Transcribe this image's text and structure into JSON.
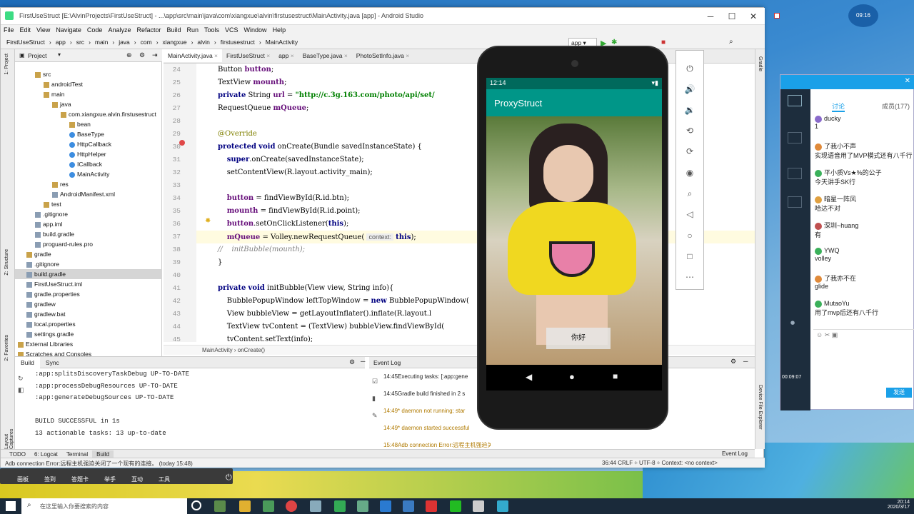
{
  "window": {
    "title": "FirstUseStruct [E:\\AlvinProjects\\FirstUseStruct] - ...\\app\\src\\main\\java\\com\\xiangxue\\alvin\\firstusestruct\\MainActivity.java [app] - Android Studio",
    "minimize": "─",
    "maximize": "☐",
    "close": "✕"
  },
  "menu": [
    "File",
    "Edit",
    "View",
    "Navigate",
    "Code",
    "Analyze",
    "Refactor",
    "Build",
    "Run",
    "Tools",
    "VCS",
    "Window",
    "Help"
  ],
  "breadcrumbs": [
    "FirstUseStruct",
    "app",
    "src",
    "main",
    "java",
    "com",
    "xiangxue",
    "alvin",
    "firstusestruct",
    "MainActivity"
  ],
  "run_config": "app",
  "project_panel": {
    "title": "Project",
    "tree": [
      {
        "label": "src",
        "indent": 2,
        "type": "folder"
      },
      {
        "label": "androidTest",
        "indent": 3,
        "type": "folder"
      },
      {
        "label": "main",
        "indent": 3,
        "type": "folder"
      },
      {
        "label": "java",
        "indent": 4,
        "type": "folder"
      },
      {
        "label": "com.xiangxue.alvin.firstusestruct",
        "indent": 5,
        "type": "folder"
      },
      {
        "label": "bean",
        "indent": 6,
        "type": "folder"
      },
      {
        "label": "BaseType",
        "indent": 6,
        "type": "cls"
      },
      {
        "label": "HttpCallback",
        "indent": 6,
        "type": "cls"
      },
      {
        "label": "HttpHelper",
        "indent": 6,
        "type": "cls"
      },
      {
        "label": "ICallback",
        "indent": 6,
        "type": "cls"
      },
      {
        "label": "MainActivity",
        "indent": 6,
        "type": "cls"
      },
      {
        "label": "res",
        "indent": 4,
        "type": "folder"
      },
      {
        "label": "AndroidManifest.xml",
        "indent": 4,
        "type": "file"
      },
      {
        "label": "test",
        "indent": 3,
        "type": "folder"
      },
      {
        "label": ".gitignore",
        "indent": 2,
        "type": "file"
      },
      {
        "label": "app.iml",
        "indent": 2,
        "type": "file"
      },
      {
        "label": "build.gradle",
        "indent": 2,
        "type": "file"
      },
      {
        "label": "proguard-rules.pro",
        "indent": 2,
        "type": "file"
      },
      {
        "label": "gradle",
        "indent": 1,
        "type": "folder"
      },
      {
        "label": ".gitignore",
        "indent": 1,
        "type": "file"
      },
      {
        "label": "build.gradle",
        "indent": 1,
        "type": "file",
        "selected": true
      },
      {
        "label": "FirstUseStruct.iml",
        "indent": 1,
        "type": "file"
      },
      {
        "label": "gradle.properties",
        "indent": 1,
        "type": "file"
      },
      {
        "label": "gradlew",
        "indent": 1,
        "type": "file"
      },
      {
        "label": "gradlew.bat",
        "indent": 1,
        "type": "file"
      },
      {
        "label": "local.properties",
        "indent": 1,
        "type": "file"
      },
      {
        "label": "settings.gradle",
        "indent": 1,
        "type": "file"
      },
      {
        "label": "External Libraries",
        "indent": 0,
        "type": "folder"
      },
      {
        "label": "Scratches and Consoles",
        "indent": 0,
        "type": "folder"
      }
    ]
  },
  "editor_tabs": [
    {
      "label": "MainActivity.java",
      "active": true
    },
    {
      "label": "FirstUseStruct",
      "active": false
    },
    {
      "label": "app",
      "active": false
    },
    {
      "label": "BaseType.java",
      "active": false
    },
    {
      "label": "PhotoSetInfo.java",
      "active": false
    }
  ],
  "code_lines": [
    {
      "n": "24",
      "t": "Button button;"
    },
    {
      "n": "25",
      "t": "TextView mounth;"
    },
    {
      "n": "26",
      "t": "private String url = \"http://c.3g.163.com/photo/api/set/"
    },
    {
      "n": "27",
      "t": "RequestQueue mQueue;"
    },
    {
      "n": "28",
      "t": ""
    },
    {
      "n": "29",
      "t": "@Override"
    },
    {
      "n": "30",
      "t": "protected void onCreate(Bundle savedInstanceState) {"
    },
    {
      "n": "31",
      "t": "    super.onCreate(savedInstanceState);"
    },
    {
      "n": "32",
      "t": "    setContentView(R.layout.activity_main);"
    },
    {
      "n": "33",
      "t": ""
    },
    {
      "n": "34",
      "t": "    button = findViewById(R.id.btn);"
    },
    {
      "n": "35",
      "t": "    mounth = findViewById(R.id.point);"
    },
    {
      "n": "36",
      "t": "    button.setOnClickListener(this);"
    },
    {
      "n": "37",
      "t": "    mQueue = Volley.newRequestQueue( context: this);"
    },
    {
      "n": "38",
      "t": "//    initBubble(mounth);"
    },
    {
      "n": "39",
      "t": "}"
    },
    {
      "n": "40",
      "t": ""
    },
    {
      "n": "41",
      "t": "private void initBubble(View view, String info){"
    },
    {
      "n": "42",
      "t": "    BubblePopupWindow leftTopWindow = new BubblePopupWindow("
    },
    {
      "n": "43",
      "t": "    View bubbleView = getLayoutInflater().inflate(R.layout.l"
    },
    {
      "n": "44",
      "t": "    TextView tvContent = (TextView) bubbleView.findViewById("
    },
    {
      "n": "45",
      "t": "    tvContent.setText(info);"
    }
  ],
  "editor_breadcrumb": "MainActivity  ›  onCreate()",
  "build_panel": {
    "tabs": [
      "Build",
      "Sync"
    ],
    "lines": [
      ":app:splitsDiscoveryTaskDebug UP-TO-DATE",
      ":app:processDebugResources UP-TO-DATE",
      ":app:generateDebugSources UP-TO-DATE",
      "",
      "BUILD SUCCESSFUL in 1s",
      "13 actionable tasks: 13 up-to-date"
    ]
  },
  "event_log": {
    "title": "Event Log",
    "entries": [
      {
        "t": "14:45Executing tasks: [:app:gene",
        "c": "#222"
      },
      {
        "t": "14:45Gradle build finished in 2 s",
        "c": "#222"
      },
      {
        "t": "14:49* daemon not running; star",
        "c": "#b07a00"
      },
      {
        "t": "14:49* daemon started successful",
        "c": "#b07a00"
      },
      {
        "t": "15:48Adb connection Error:远程主机强迫关闭了一个现有的连接。",
        "c": "#b07a00"
      }
    ]
  },
  "tool_windows": [
    "TODO",
    "6: Logcat",
    "Terminal",
    "Build"
  ],
  "event_log_button": "Event Log",
  "status_left": "Adb connection Error:远程主机强迫关闭了一个现有的连接。 (today 15:48)",
  "status_right": "36:44   CRLF ÷   UTF-8 ÷   Context: <no context>",
  "phone": {
    "time": "12:14",
    "app_title": "ProxyStruct",
    "button_label": "你好"
  },
  "qq": {
    "tabs": [
      "讨论",
      "成员(177)"
    ],
    "messages": [
      {
        "u": "ducky",
        "c": "1",
        "col": "#8a6acb"
      },
      {
        "u": "了我小不声",
        "c": "实现语音用了MVP模式还有八千行",
        "col": "#e08a3a"
      },
      {
        "u": "平小质Vs★%的公子",
        "c": "今天讲手SK行",
        "col": "#3ab05a"
      },
      {
        "u": "暗星一阵风",
        "c": "哈达不对",
        "col": "#e0a040"
      },
      {
        "u": "深圳~huang",
        "c": "有",
        "col": "#c05050"
      },
      {
        "u": "YWQ",
        "c": "volley",
        "col": "#3ab05a"
      },
      {
        "u": "了我亦不在",
        "c": "glide",
        "col": "#e08a3a"
      },
      {
        "u": "MutaoYu",
        "c": "用了mvp后还有八千行",
        "col": "#3ab05a"
      }
    ],
    "send": "发送",
    "time_label": "00:09:07"
  },
  "clock_widget": "09:16",
  "float_toolbar": [
    "画板",
    "签到",
    "答题卡",
    "举手",
    "互动",
    "工具"
  ],
  "taskbar": {
    "search_placeholder": "在这里输入你要搜索的内容",
    "time": "20:14",
    "date": "2020/3/17"
  }
}
